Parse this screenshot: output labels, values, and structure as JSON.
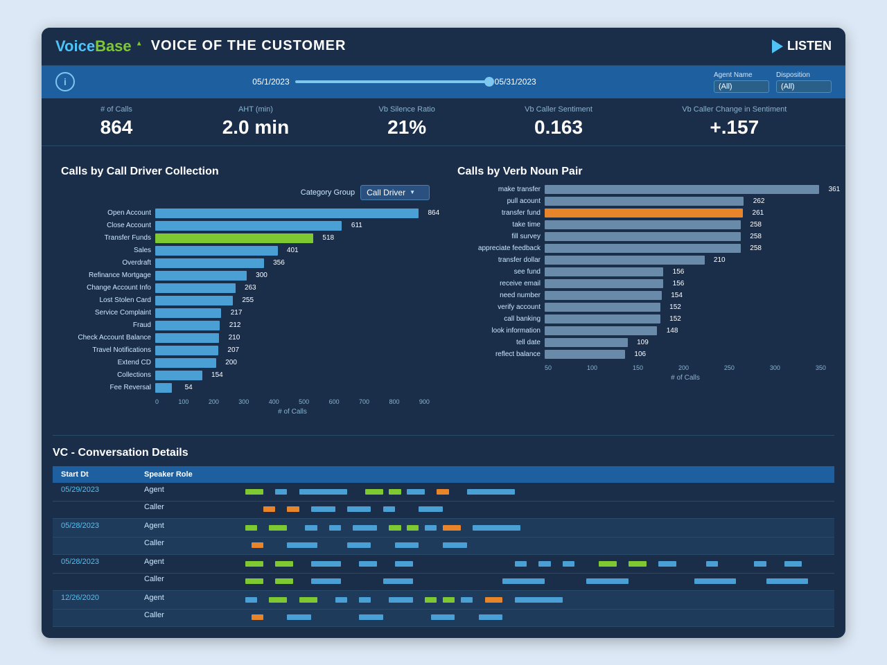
{
  "header": {
    "logo_voice": "Voice",
    "logo_base": "Base",
    "title": "VOICE OF THE CUSTOMER",
    "listen_label": "LISTEN"
  },
  "filter_bar": {
    "info_symbol": "i",
    "date_start": "05/1/2023",
    "date_end": "05/31/2023",
    "agent_name_label": "Agent Name",
    "agent_name_value": "(All)",
    "disposition_label": "Disposition",
    "disposition_value": "(All)"
  },
  "metrics": [
    {
      "label": "# of Calls",
      "value": "864"
    },
    {
      "label": "AHT (min)",
      "value": "2.0 min"
    },
    {
      "label": "Vb Silence Ratio",
      "value": "21%"
    },
    {
      "label": "Vb Caller Sentiment",
      "value": "0.163"
    },
    {
      "label": "Vb Caller Change in Sentiment",
      "value": "+.157"
    }
  ],
  "left_chart": {
    "title": "Calls by Call Driver Collection",
    "category_group_label": "Category Group",
    "category_dropdown": "Call Driver",
    "x_axis_labels": [
      "0",
      "100",
      "200",
      "300",
      "400",
      "500",
      "600",
      "700",
      "800",
      "900"
    ],
    "x_axis_title": "# of Calls",
    "bars": [
      {
        "label": "Open Account",
        "value": 864,
        "max": 900,
        "color": "blue"
      },
      {
        "label": "Close Account",
        "value": 611,
        "max": 900,
        "color": "blue"
      },
      {
        "label": "Transfer Funds",
        "value": 518,
        "max": 900,
        "color": "green"
      },
      {
        "label": "Sales",
        "value": 401,
        "max": 900,
        "color": "blue"
      },
      {
        "label": "Overdraft",
        "value": 356,
        "max": 900,
        "color": "blue"
      },
      {
        "label": "Refinance Mortgage",
        "value": 300,
        "max": 900,
        "color": "blue"
      },
      {
        "label": "Change Account Info",
        "value": 263,
        "max": 900,
        "color": "blue"
      },
      {
        "label": "Lost Stolen Card",
        "value": 255,
        "max": 900,
        "color": "blue"
      },
      {
        "label": "Service Complaint",
        "value": 217,
        "max": 900,
        "color": "blue"
      },
      {
        "label": "Fraud",
        "value": 212,
        "max": 900,
        "color": "blue"
      },
      {
        "label": "Check Account Balance",
        "value": 210,
        "max": 900,
        "color": "blue"
      },
      {
        "label": "Travel Notifications",
        "value": 207,
        "max": 900,
        "color": "blue"
      },
      {
        "label": "Extend CD",
        "value": 200,
        "max": 900,
        "color": "blue"
      },
      {
        "label": "Collections",
        "value": 154,
        "max": 900,
        "color": "blue"
      },
      {
        "label": "Fee Reversal",
        "value": 54,
        "max": 900,
        "color": "blue"
      }
    ]
  },
  "right_chart": {
    "title": "Calls by Verb Noun Pair",
    "x_axis_labels": [
      "50",
      "100",
      "150",
      "200",
      "250",
      "300",
      "350"
    ],
    "x_axis_title": "# of Calls",
    "bars": [
      {
        "label": "make transfer",
        "value": 361,
        "max": 370,
        "color": "gray"
      },
      {
        "label": "pull acount",
        "value": 262,
        "max": 370,
        "color": "gray"
      },
      {
        "label": "transfer fund",
        "value": 261,
        "max": 370,
        "color": "orange"
      },
      {
        "label": "take time",
        "value": 258,
        "max": 370,
        "color": "gray"
      },
      {
        "label": "fill survey",
        "value": 258,
        "max": 370,
        "color": "gray"
      },
      {
        "label": "appreciate feedback",
        "value": 258,
        "max": 370,
        "color": "gray"
      },
      {
        "label": "transfer dollar",
        "value": 210,
        "max": 370,
        "color": "gray"
      },
      {
        "label": "see fund",
        "value": 156,
        "max": 370,
        "color": "gray"
      },
      {
        "label": "receive email",
        "value": 156,
        "max": 370,
        "color": "gray"
      },
      {
        "label": "need number",
        "value": 154,
        "max": 370,
        "color": "gray"
      },
      {
        "label": "verify account",
        "value": 152,
        "max": 370,
        "color": "gray"
      },
      {
        "label": "call banking",
        "value": 152,
        "max": 370,
        "color": "gray"
      },
      {
        "label": "look information",
        "value": 148,
        "max": 370,
        "color": "gray"
      },
      {
        "label": "tell date",
        "value": 109,
        "max": 370,
        "color": "gray"
      },
      {
        "label": "reflect balance",
        "value": 106,
        "max": 370,
        "color": "gray"
      }
    ]
  },
  "bottom_section": {
    "title": "VC - Conversation Details",
    "headers": [
      "Start Dt",
      "Speaker Role"
    ],
    "rows": [
      {
        "date": "05/29/2023",
        "speakers": [
          {
            "role": "Agent",
            "segments": [
              {
                "left": "3%",
                "width": "3%",
                "color": "green"
              },
              {
                "left": "8%",
                "width": "2%",
                "color": "blue"
              },
              {
                "left": "12%",
                "width": "8%",
                "color": "blue"
              },
              {
                "left": "23%",
                "width": "3%",
                "color": "green"
              },
              {
                "left": "27%",
                "width": "2%",
                "color": "green"
              },
              {
                "left": "30%",
                "width": "3%",
                "color": "blue"
              },
              {
                "left": "35%",
                "width": "2%",
                "color": "orange"
              },
              {
                "left": "40%",
                "width": "8%",
                "color": "blue"
              }
            ]
          },
          {
            "role": "Caller",
            "segments": [
              {
                "left": "6%",
                "width": "2%",
                "color": "orange"
              },
              {
                "left": "10%",
                "width": "2%",
                "color": "orange"
              },
              {
                "left": "14%",
                "width": "4%",
                "color": "blue"
              },
              {
                "left": "20%",
                "width": "4%",
                "color": "blue"
              },
              {
                "left": "26%",
                "width": "2%",
                "color": "blue"
              },
              {
                "left": "32%",
                "width": "4%",
                "color": "blue"
              }
            ]
          }
        ]
      },
      {
        "date": "05/28/2023",
        "speakers": [
          {
            "role": "Agent",
            "segments": [
              {
                "left": "3%",
                "width": "2%",
                "color": "green"
              },
              {
                "left": "7%",
                "width": "3%",
                "color": "green"
              },
              {
                "left": "13%",
                "width": "2%",
                "color": "blue"
              },
              {
                "left": "17%",
                "width": "2%",
                "color": "blue"
              },
              {
                "left": "21%",
                "width": "4%",
                "color": "blue"
              },
              {
                "left": "27%",
                "width": "2%",
                "color": "green"
              },
              {
                "left": "30%",
                "width": "2%",
                "color": "green"
              },
              {
                "left": "33%",
                "width": "2%",
                "color": "blue"
              },
              {
                "left": "36%",
                "width": "3%",
                "color": "orange"
              },
              {
                "left": "41%",
                "width": "8%",
                "color": "blue"
              }
            ]
          },
          {
            "role": "Caller",
            "segments": [
              {
                "left": "4%",
                "width": "2%",
                "color": "orange"
              },
              {
                "left": "10%",
                "width": "5%",
                "color": "blue"
              },
              {
                "left": "20%",
                "width": "4%",
                "color": "blue"
              },
              {
                "left": "28%",
                "width": "4%",
                "color": "blue"
              },
              {
                "left": "36%",
                "width": "4%",
                "color": "blue"
              }
            ]
          }
        ]
      },
      {
        "date": "05/28/2023",
        "speakers": [
          {
            "role": "Agent",
            "segments": [
              {
                "left": "3%",
                "width": "3%",
                "color": "green"
              },
              {
                "left": "8%",
                "width": "3%",
                "color": "green"
              },
              {
                "left": "14%",
                "width": "5%",
                "color": "blue"
              },
              {
                "left": "22%",
                "width": "3%",
                "color": "blue"
              },
              {
                "left": "28%",
                "width": "3%",
                "color": "blue"
              },
              {
                "left": "48%",
                "width": "2%",
                "color": "blue"
              },
              {
                "left": "52%",
                "width": "2%",
                "color": "blue"
              },
              {
                "left": "56%",
                "width": "2%",
                "color": "blue"
              },
              {
                "left": "62%",
                "width": "3%",
                "color": "green"
              },
              {
                "left": "67%",
                "width": "3%",
                "color": "green"
              },
              {
                "left": "72%",
                "width": "3%",
                "color": "blue"
              },
              {
                "left": "80%",
                "width": "2%",
                "color": "blue"
              },
              {
                "left": "88%",
                "width": "2%",
                "color": "blue"
              },
              {
                "left": "93%",
                "width": "3%",
                "color": "blue"
              }
            ]
          },
          {
            "role": "Caller",
            "segments": [
              {
                "left": "3%",
                "width": "3%",
                "color": "green"
              },
              {
                "left": "8%",
                "width": "3%",
                "color": "green"
              },
              {
                "left": "14%",
                "width": "5%",
                "color": "blue"
              },
              {
                "left": "26%",
                "width": "5%",
                "color": "blue"
              },
              {
                "left": "46%",
                "width": "7%",
                "color": "blue"
              },
              {
                "left": "60%",
                "width": "7%",
                "color": "blue"
              },
              {
                "left": "78%",
                "width": "7%",
                "color": "blue"
              },
              {
                "left": "90%",
                "width": "7%",
                "color": "blue"
              }
            ]
          }
        ]
      },
      {
        "date": "12/26/2020",
        "speakers": [
          {
            "role": "Agent",
            "segments": [
              {
                "left": "3%",
                "width": "2%",
                "color": "blue"
              },
              {
                "left": "7%",
                "width": "3%",
                "color": "green"
              },
              {
                "left": "12%",
                "width": "3%",
                "color": "green"
              },
              {
                "left": "18%",
                "width": "2%",
                "color": "blue"
              },
              {
                "left": "22%",
                "width": "2%",
                "color": "blue"
              },
              {
                "left": "27%",
                "width": "4%",
                "color": "blue"
              },
              {
                "left": "33%",
                "width": "2%",
                "color": "green"
              },
              {
                "left": "36%",
                "width": "2%",
                "color": "green"
              },
              {
                "left": "39%",
                "width": "2%",
                "color": "blue"
              },
              {
                "left": "43%",
                "width": "3%",
                "color": "orange"
              },
              {
                "left": "48%",
                "width": "8%",
                "color": "blue"
              }
            ]
          },
          {
            "role": "Caller",
            "segments": [
              {
                "left": "4%",
                "width": "2%",
                "color": "orange"
              },
              {
                "left": "10%",
                "width": "4%",
                "color": "blue"
              },
              {
                "left": "22%",
                "width": "4%",
                "color": "blue"
              },
              {
                "left": "34%",
                "width": "4%",
                "color": "blue"
              },
              {
                "left": "42%",
                "width": "4%",
                "color": "blue"
              }
            ]
          }
        ]
      }
    ]
  }
}
